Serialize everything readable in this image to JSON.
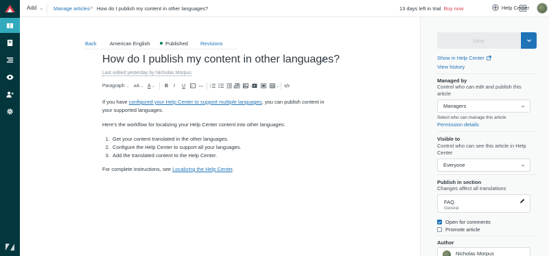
{
  "leftnav": {
    "items": [
      "guide-icon",
      "articles-icon",
      "arrange-icon",
      "preview-icon",
      "user-permissions-icon",
      "settings-icon"
    ],
    "active_index": 0
  },
  "topbar": {
    "add_label": "Add",
    "breadcrumb_parent": "Manage articles",
    "breadcrumb_separator": ">",
    "breadcrumb_current": "How do I publish my content in other languages?",
    "trial_text": "13 days left in trial.",
    "buy_label": "Buy now",
    "help_center_label": "Help Center"
  },
  "editor": {
    "back_label": "Back",
    "language": "American English",
    "status": "Published",
    "revisions_label": "Revisions",
    "title": "How do I publish my content in other languages?",
    "last_edited": "Last edited yesterday by Nicholas Morpus",
    "toolbar": {
      "paragraph_label": "Paragraph",
      "font_size_label": "A",
      "items": [
        "bold",
        "italic",
        "underline",
        "code-block",
        "ordered-list",
        "unordered-list",
        "outdent",
        "indent",
        "align",
        "link",
        "image",
        "video",
        "media",
        "table",
        "source-code"
      ]
    },
    "body": {
      "p1_before": "If you have ",
      "p1_link": "configured your Help Center to support multiple languages",
      "p1_after": ", you can publish content in your supported languages.",
      "p2": "Here's the workflow for localizing your Help Center content into other languages:",
      "steps": [
        "Get your content translated in the other languages.",
        "Configure the Help Center to support all your languages.",
        "Add the translated content to the Help Center."
      ],
      "p3_before": "For complete instructions, see ",
      "p3_link": "Localizing the Help Center",
      "p3_after": "."
    }
  },
  "sidebar": {
    "save_label": "Save",
    "show_in_hc_label": "Show in Help Center",
    "view_history_label": "View history",
    "managed_by": {
      "heading": "Managed by",
      "desc": "Control who can edit and publish this article",
      "value": "Managers",
      "hint": "Select who can manage this article",
      "link": "Permission details"
    },
    "visible_to": {
      "heading": "Visible to",
      "desc": "Control who can see this article in Help Center",
      "value": "Everyone"
    },
    "publish_in_section": {
      "heading": "Publish in section",
      "desc": "Changes affect all translations",
      "section_name": "FAQ",
      "section_category": "General"
    },
    "open_for_comments": {
      "label": "Open for comments",
      "checked": true
    },
    "promote_article": {
      "label": "Promote article",
      "checked": false
    },
    "author": {
      "heading": "Author",
      "name": "Nicholas Morpus"
    }
  },
  "colors": {
    "nav_bg": "#03363d",
    "nav_active": "#30aabc",
    "link": "#1f73b7",
    "published_dot": "#038153",
    "buy_now": "#d93f4c"
  }
}
